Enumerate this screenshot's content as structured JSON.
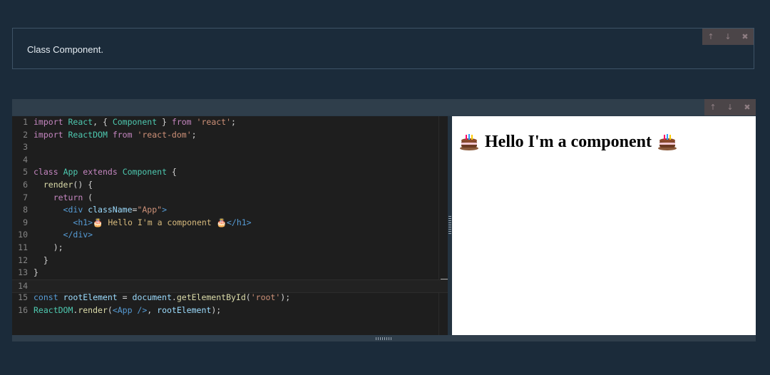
{
  "markdown_cell": {
    "text": "Class Component."
  },
  "toolbar_icons": {
    "up": "↑",
    "down": "↓",
    "delete": "✖"
  },
  "editor": {
    "lines": [
      {
        "n": "1",
        "tokens": [
          [
            "kw",
            "import"
          ],
          [
            "plain",
            " "
          ],
          [
            "id",
            "React"
          ],
          [
            "plain",
            ", { "
          ],
          [
            "id",
            "Component"
          ],
          [
            "plain",
            " } "
          ],
          [
            "kw",
            "from"
          ],
          [
            "plain",
            " "
          ],
          [
            "str",
            "'react'"
          ],
          [
            "plain",
            ";"
          ]
        ]
      },
      {
        "n": "2",
        "tokens": [
          [
            "kw",
            "import"
          ],
          [
            "plain",
            " "
          ],
          [
            "id",
            "ReactDOM"
          ],
          [
            "plain",
            " "
          ],
          [
            "kw",
            "from"
          ],
          [
            "plain",
            " "
          ],
          [
            "str",
            "'react-dom'"
          ],
          [
            "plain",
            ";"
          ]
        ]
      },
      {
        "n": "3",
        "tokens": []
      },
      {
        "n": "4",
        "tokens": []
      },
      {
        "n": "5",
        "tokens": [
          [
            "kw",
            "class"
          ],
          [
            "plain",
            " "
          ],
          [
            "id",
            "App"
          ],
          [
            "plain",
            " "
          ],
          [
            "kw",
            "extends"
          ],
          [
            "plain",
            " "
          ],
          [
            "id",
            "Component"
          ],
          [
            "plain",
            " {"
          ]
        ]
      },
      {
        "n": "6",
        "tokens": [
          [
            "plain",
            "  "
          ],
          [
            "fn",
            "render"
          ],
          [
            "plain",
            "() {"
          ]
        ]
      },
      {
        "n": "7",
        "tokens": [
          [
            "plain",
            "    "
          ],
          [
            "kw",
            "return"
          ],
          [
            "plain",
            " ("
          ]
        ]
      },
      {
        "n": "8",
        "tokens": [
          [
            "plain",
            "      "
          ],
          [
            "tag",
            "<div"
          ],
          [
            "plain",
            " "
          ],
          [
            "attr",
            "className"
          ],
          [
            "plain",
            "="
          ],
          [
            "str",
            "\"App\""
          ],
          [
            "tag",
            ">"
          ]
        ]
      },
      {
        "n": "9",
        "tokens": [
          [
            "plain",
            "        "
          ],
          [
            "tag",
            "<h1>"
          ],
          [
            "jsxtext",
            "🎂 Hello I'm a component 🎂"
          ],
          [
            "tag",
            "</h1>"
          ]
        ]
      },
      {
        "n": "10",
        "tokens": [
          [
            "plain",
            "      "
          ],
          [
            "tag",
            "</div>"
          ]
        ]
      },
      {
        "n": "11",
        "tokens": [
          [
            "plain",
            "    );"
          ]
        ]
      },
      {
        "n": "12",
        "tokens": [
          [
            "plain",
            "  }"
          ]
        ]
      },
      {
        "n": "13",
        "tokens": [
          [
            "plain",
            "}"
          ]
        ]
      },
      {
        "n": "14",
        "tokens": []
      },
      {
        "n": "15",
        "tokens": [
          [
            "kw2",
            "const"
          ],
          [
            "plain",
            " "
          ],
          [
            "var",
            "rootElement"
          ],
          [
            "plain",
            " = "
          ],
          [
            "var",
            "document"
          ],
          [
            "plain",
            "."
          ],
          [
            "fn",
            "getElementById"
          ],
          [
            "plain",
            "("
          ],
          [
            "str",
            "'root'"
          ],
          [
            "plain",
            ");"
          ]
        ]
      },
      {
        "n": "16",
        "tokens": [
          [
            "id",
            "ReactDOM"
          ],
          [
            "plain",
            "."
          ],
          [
            "fn",
            "render"
          ],
          [
            "plain",
            "("
          ],
          [
            "tag",
            "<App />"
          ],
          [
            "plain",
            ", "
          ],
          [
            "var",
            "rootElement"
          ],
          [
            "plain",
            ");"
          ]
        ]
      }
    ]
  },
  "preview": {
    "heading_text": "Hello I'm a component"
  }
}
